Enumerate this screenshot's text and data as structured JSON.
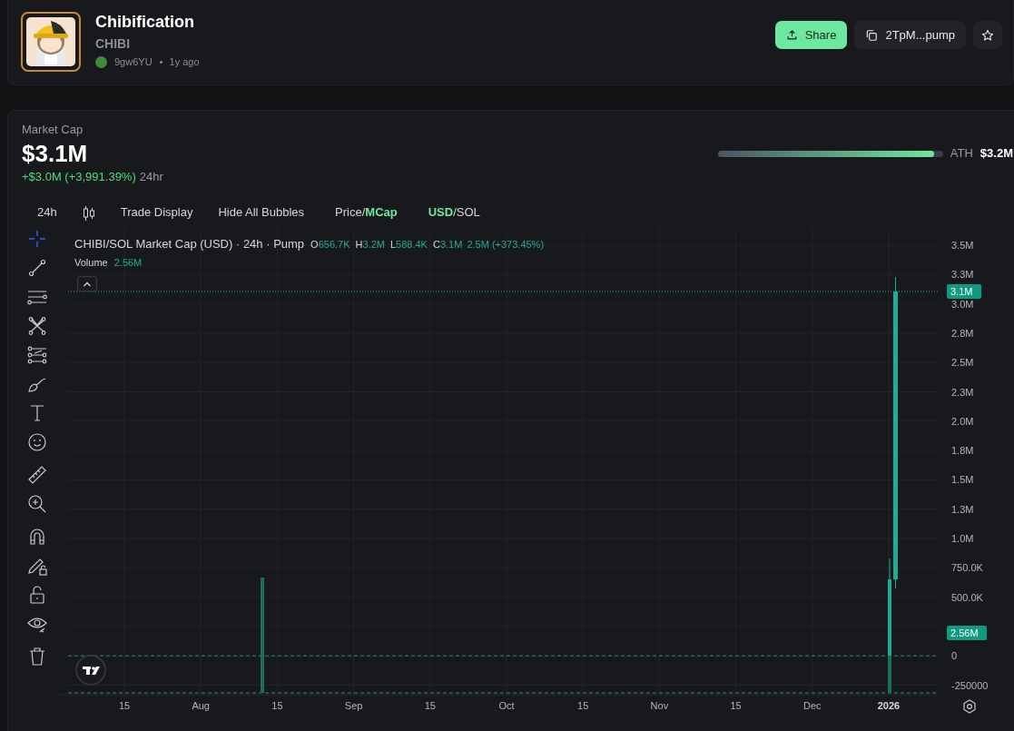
{
  "token": {
    "name": "Chibification",
    "symbol": "CHIBI",
    "creator": "9gw6YU",
    "age": "1y ago"
  },
  "actions": {
    "share": "Share",
    "address": "2TpM...pump"
  },
  "market_cap": {
    "label": "Market Cap",
    "value": "$3.1M",
    "change": "+$3.0M (+3,991.39%)",
    "period": "24hr",
    "ath_label": "ATH",
    "ath_value": "$3.2M",
    "level": 0.96
  },
  "chart_toolbar": [
    {
      "kind": "button",
      "label": "24h"
    },
    {
      "kind": "candles"
    },
    {
      "kind": "button",
      "label": "Trade Display"
    },
    {
      "kind": "button",
      "label": "Hide All Bubbles"
    },
    {
      "kind": "toggle",
      "separator": "/",
      "options": [
        {
          "label": "Price",
          "selected": false
        },
        {
          "label": "MCap",
          "selected": true
        }
      ]
    },
    {
      "kind": "toggle",
      "separator": "/",
      "options": [
        {
          "label": "USD",
          "selected": true
        },
        {
          "label": "SOL",
          "selected": false
        }
      ]
    }
  ],
  "drawing_tools": [
    {
      "kind": "crosshair",
      "selected": true
    },
    {
      "kind": "trend-line",
      "selected": false
    },
    {
      "kind": "horizontal-lines",
      "selected": false
    },
    {
      "kind": "pattern",
      "selected": false
    },
    {
      "kind": "fib",
      "selected": false
    },
    {
      "kind": "brush",
      "selected": false
    },
    {
      "kind": "text",
      "selected": false
    },
    {
      "kind": "emoji",
      "selected": false
    },
    {
      "kind": "ruler",
      "selected": false
    },
    {
      "kind": "zoom",
      "selected": false
    },
    {
      "kind": "magnet",
      "selected": false
    },
    {
      "kind": "lock-drawing",
      "selected": false
    },
    {
      "kind": "lock",
      "selected": false
    },
    {
      "kind": "eye",
      "selected": false
    },
    {
      "kind": "trash",
      "selected": false
    }
  ],
  "chart": {
    "legend": {
      "title": "CHIBI/SOL Market Cap (USD) · 24h · Pump",
      "ohlc": [
        {
          "key": "O",
          "value": "656.7K"
        },
        {
          "key": "H",
          "value": "3.2M"
        },
        {
          "key": "L",
          "value": "588.4K"
        },
        {
          "key": "C",
          "value": "3.1M"
        }
      ],
      "change": "2.5M (+373.45%)",
      "volume_label": "Volume",
      "volume": "2.56M"
    },
    "price_axis": [
      "3.5M",
      "3.3M",
      "3.0M",
      "2.8M",
      "2.5M",
      "2.3M",
      "2.0M",
      "1.8M",
      "1.5M",
      "1.3M",
      "1.0M",
      "750.0K",
      "500.0K",
      "0",
      "-250000"
    ],
    "time_axis": [
      {
        "kind": "date",
        "label": "15"
      },
      {
        "kind": "date",
        "label": "Aug"
      },
      {
        "kind": "date",
        "label": "15"
      },
      {
        "kind": "date",
        "label": "Sep"
      },
      {
        "kind": "date",
        "label": "15"
      },
      {
        "kind": "date",
        "label": "Oct"
      },
      {
        "kind": "date",
        "label": "15"
      },
      {
        "kind": "date",
        "label": "Nov"
      },
      {
        "kind": "date",
        "label": "15"
      },
      {
        "kind": "date",
        "label": "Dec"
      },
      {
        "kind": "year",
        "label": "2026"
      }
    ],
    "last_value": "3.1M",
    "last_volume": "2.56M"
  }
}
